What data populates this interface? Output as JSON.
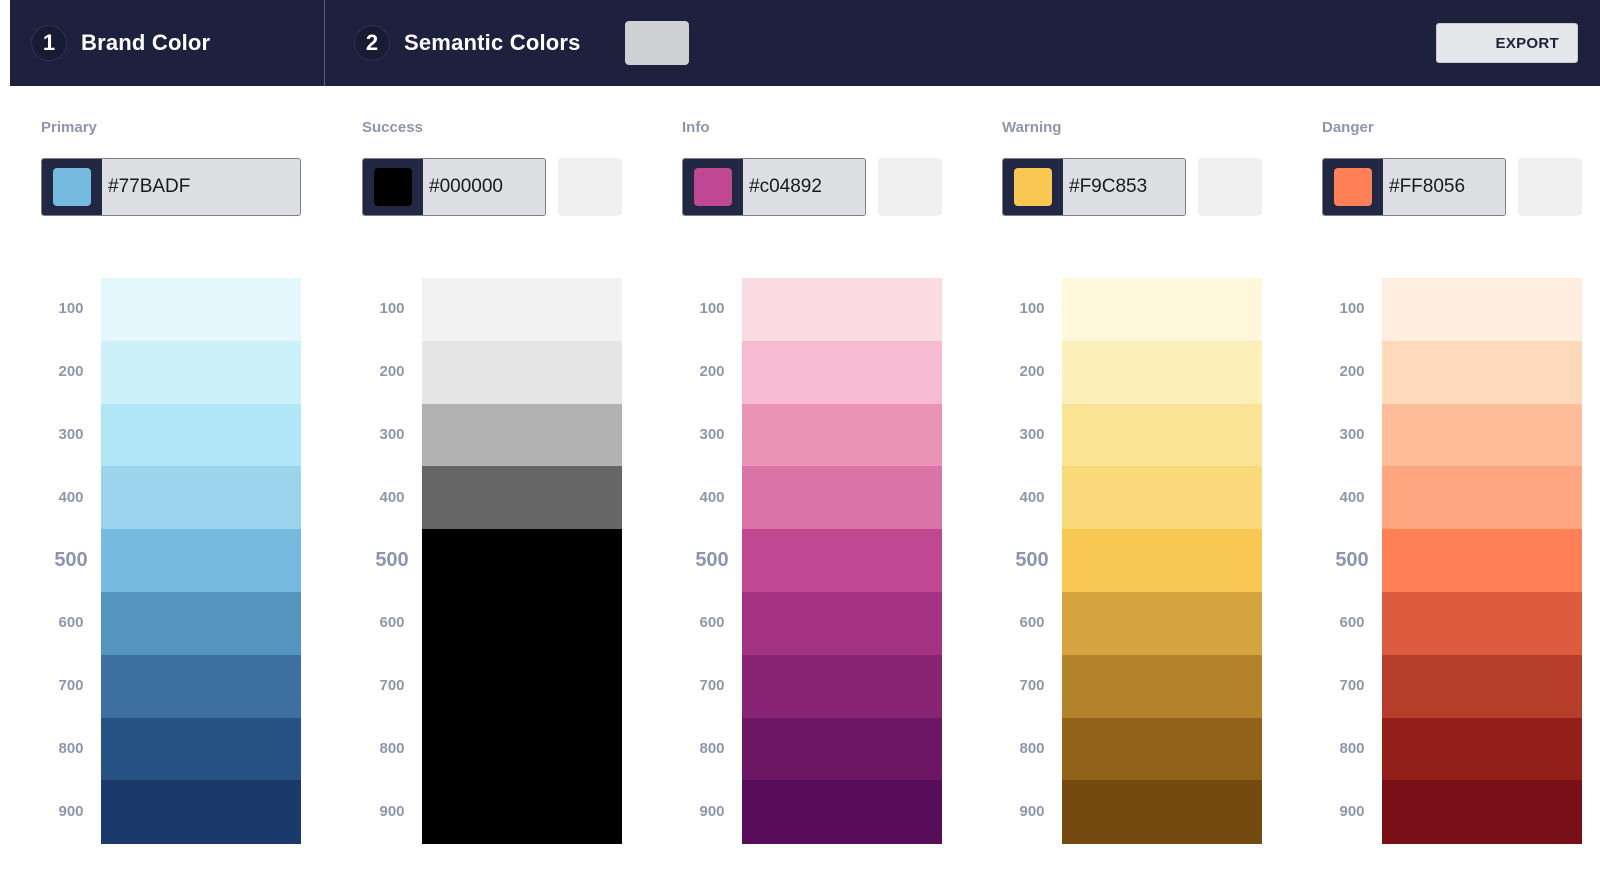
{
  "header": {
    "steps": [
      {
        "number": "1",
        "title": "Brand Color"
      },
      {
        "number": "2",
        "title": "Semantic Colors"
      }
    ],
    "export_label": "EXPORT"
  },
  "palettes": [
    {
      "label": "Primary",
      "hex": "#77BADF",
      "chip_color": "#77BADF",
      "tones": [
        "100",
        "200",
        "300",
        "400",
        "500",
        "600",
        "700",
        "800",
        "900"
      ],
      "shades": [
        "#e3f8fc",
        "#ccf1fa",
        "#b0e6f5",
        "#9bd4ec",
        "#77badf",
        "#5694c0",
        "#3d6fa0",
        "#265383",
        "#1a3a6c"
      ]
    },
    {
      "label": "Success",
      "hex": "#000000",
      "chip_color": "#000000",
      "tones": [
        "100",
        "200",
        "300",
        "400",
        "500",
        "600",
        "700",
        "800",
        "900"
      ],
      "shades": [
        "#f2f2f2",
        "#e5e5e5",
        "#b2b2b2",
        "#666666",
        "#000000",
        "#000000",
        "#000000",
        "#000000",
        "#000000"
      ]
    },
    {
      "label": "Info",
      "hex": "#c04892",
      "chip_color": "#c04892",
      "tones": [
        "100",
        "200",
        "300",
        "400",
        "500",
        "600",
        "700",
        "800",
        "900"
      ],
      "shades": [
        "#fadbe2",
        "#f6bbd0",
        "#eb93b5",
        "#da74a6",
        "#c04892",
        "#a43483",
        "#892474",
        "#6c1664",
        "#580d5b"
      ]
    },
    {
      "label": "Warning",
      "hex": "#F9C853",
      "chip_color": "#F9C853",
      "tones": [
        "100",
        "200",
        "300",
        "400",
        "500",
        "600",
        "700",
        "800",
        "900"
      ],
      "shades": [
        "#fef7dc",
        "#fdefb9",
        "#fbe395",
        "#fad97b",
        "#f9c853",
        "#d6a43e",
        "#b3822a",
        "#90621c",
        "#744a11"
      ]
    },
    {
      "label": "Danger",
      "hex": "#FF8056",
      "chip_color": "#FF8056",
      "tones": [
        "100",
        "200",
        "300",
        "400",
        "500",
        "600",
        "700",
        "800",
        "900"
      ],
      "shades": [
        "#ffeedf",
        "#ffd9bb",
        "#ffbe99",
        "#ffa57f",
        "#ff8056",
        "#db5c3e",
        "#b73d2b",
        "#931f1b",
        "#7a1017"
      ]
    }
  ]
}
